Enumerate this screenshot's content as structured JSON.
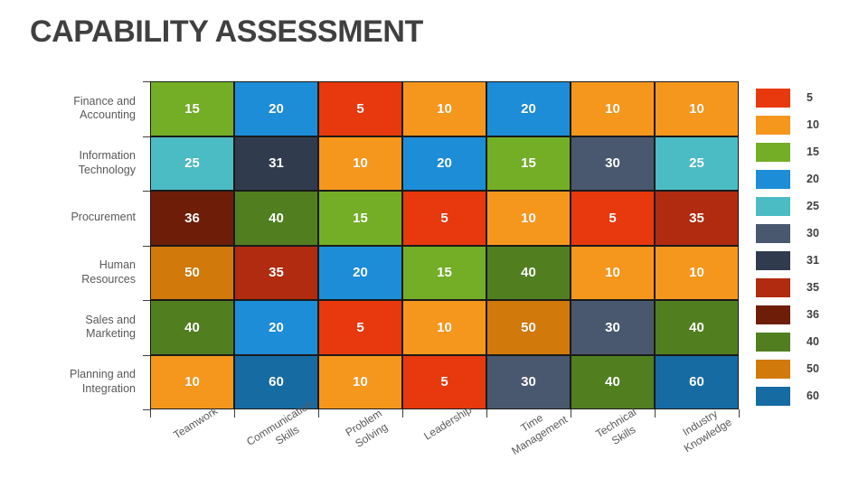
{
  "title": "CAPABILITY ASSESSMENT",
  "chart_data": {
    "type": "heatmap",
    "title": "CAPABILITY ASSESSMENT",
    "xlabel": "",
    "ylabel": "",
    "grid": false,
    "legend_position": "right",
    "categories": [
      "Teamwork",
      "Communication Skills",
      "Problem Solving",
      "Leadership",
      "Time Management",
      "Technical Skills",
      "Industry Knowledge"
    ],
    "rows": [
      "Finance and Accounting",
      "Information Technology",
      "Procurement",
      "Human Resources",
      "Sales and Marketing",
      "Planning and Integration"
    ],
    "values": [
      [
        15,
        20,
        5,
        10,
        20,
        10,
        10
      ],
      [
        25,
        31,
        10,
        20,
        15,
        30,
        25
      ],
      [
        36,
        40,
        15,
        5,
        10,
        5,
        35
      ],
      [
        50,
        35,
        20,
        15,
        40,
        10,
        10
      ],
      [
        40,
        20,
        5,
        10,
        50,
        30,
        40
      ],
      [
        10,
        60,
        10,
        5,
        30,
        40,
        60
      ]
    ],
    "value_colors": {
      "5": "#E8380D",
      "10": "#F6971D",
      "15": "#74AE26",
      "20": "#1D8DD8",
      "25": "#4CBCC4",
      "30": "#49586E",
      "31": "#303C4E",
      "35": "#B02B10",
      "36": "#6E1D08",
      "40": "#517F20",
      "50": "#D2790B",
      "60": "#166BA3"
    },
    "legend": [
      {
        "label": "5",
        "color": "#E8380D"
      },
      {
        "label": "10",
        "color": "#F6971D"
      },
      {
        "label": "15",
        "color": "#74AE26"
      },
      {
        "label": "20",
        "color": "#1D8DD8"
      },
      {
        "label": "25",
        "color": "#4CBCC4"
      },
      {
        "label": "30",
        "color": "#49586E"
      },
      {
        "label": "31",
        "color": "#303C4E"
      },
      {
        "label": "35",
        "color": "#B02B10"
      },
      {
        "label": "36",
        "color": "#6E1D08"
      },
      {
        "label": "40",
        "color": "#517F20"
      },
      {
        "label": "50",
        "color": "#D2790B"
      },
      {
        "label": "60",
        "color": "#166BA3"
      }
    ]
  },
  "column_labels_wrapped": [
    "Teamwork",
    "Communication\nSkills",
    "Problem\nSolving",
    "Leadership",
    "Time\nManagement",
    "Technical\nSkills",
    "Industry\nKnowledge"
  ],
  "row_labels_wrapped": [
    "Finance and\nAccounting",
    "Information\nTechnology",
    "Procurement",
    "Human\nResources",
    "Sales and\nMarketing",
    "Planning and\nIntegration"
  ]
}
